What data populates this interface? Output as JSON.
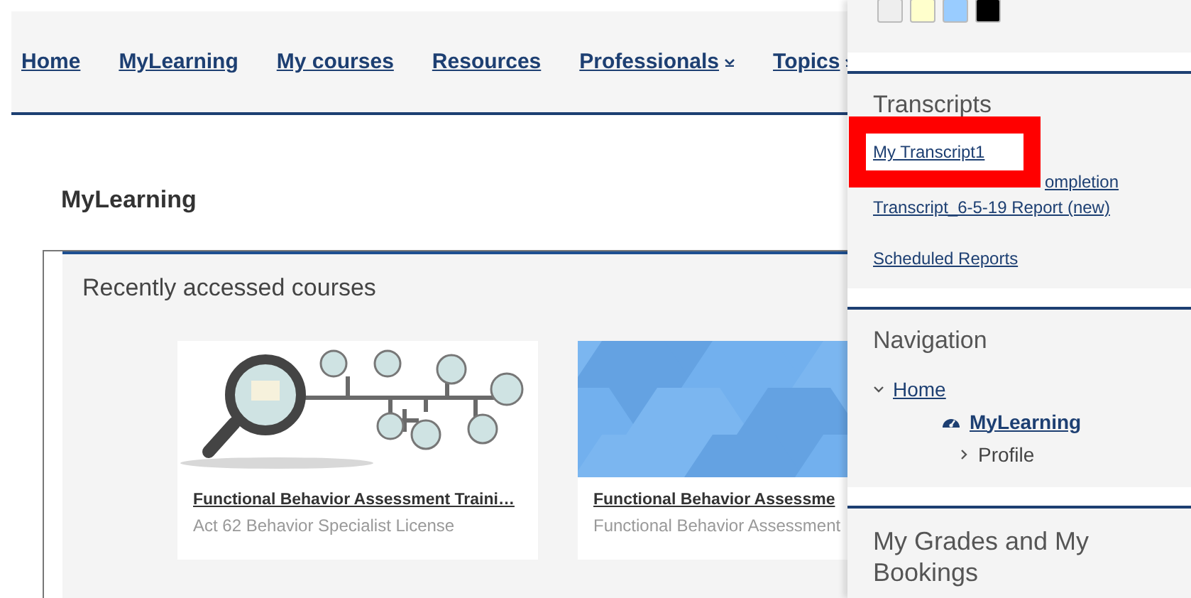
{
  "header": {
    "nav": [
      {
        "label": "Home",
        "dropdown": false
      },
      {
        "label": "MyLearning",
        "dropdown": false
      },
      {
        "label": "My courses",
        "dropdown": false
      },
      {
        "label": "Resources",
        "dropdown": false
      },
      {
        "label": "Professionals",
        "dropdown": true
      },
      {
        "label": "Topics",
        "dropdown": true
      }
    ]
  },
  "page_title": "MyLearning",
  "recent": {
    "title": "Recently accessed courses",
    "courses": [
      {
        "title": "Functional Behavior Assessment Traini…",
        "subtitle": "Act 62 Behavior Specialist License",
        "image": {
          "kind": "diagram"
        }
      },
      {
        "title": "Functional Behavior Assessme",
        "subtitle": "Functional Behavior Assessment",
        "image": {
          "kind": "hexagons"
        }
      }
    ]
  },
  "drawer": {
    "contrast_buttons": [
      {
        "color": "#eeeeee"
      },
      {
        "color": "#ffffcc"
      },
      {
        "color": "#99ccff"
      },
      {
        "color": "#000000"
      }
    ],
    "transcripts": {
      "title": "Transcripts",
      "links": [
        {
          "label": "My Transcript1",
          "kind": "framed"
        },
        {
          "label": "ompletion",
          "kind": "partly_hidden"
        },
        {
          "label": "Transcript_6-5-19 Report (new)",
          "kind": "plain"
        }
      ],
      "report_links": [
        "Scheduled Reports"
      ]
    },
    "navigation": {
      "title": "Navigation",
      "tree": [
        {
          "label": "Home",
          "kind": "link",
          "expanded": true,
          "children": [
            {
              "label": "MyLearning",
              "kind": "current"
            },
            {
              "label": "Profile",
              "kind": "branch",
              "expanded": false
            }
          ]
        }
      ]
    },
    "grades_title": "My Grades and My Bookings"
  }
}
